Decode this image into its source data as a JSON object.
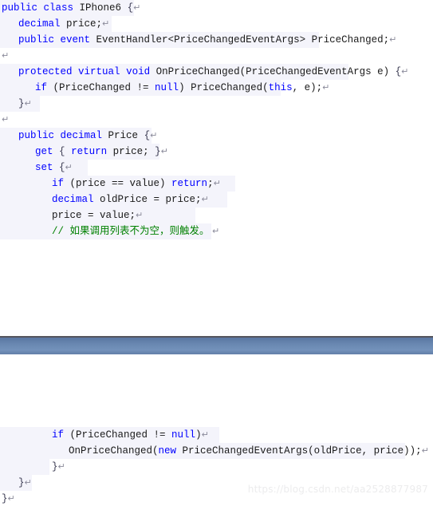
{
  "document": {
    "kind": "code-snippet-screenshot",
    "language": "C#",
    "watermark": "https://blog.csdn.net/aa2528877987",
    "colors": {
      "keyword": "#0000ff",
      "identifier": "#1a1a1a",
      "comment": "#008000",
      "pilcrow": "#8a8a9a",
      "line_wash": "#f4f4fb",
      "band_top": "#55555d",
      "band_fill_light": "#7391ba",
      "band_fill_dark": "#5a77a2",
      "watermark": "#ececed"
    },
    "paragraph_mark": "↵"
  },
  "blocks": [
    {
      "name": "top-block",
      "lines": [
        {
          "indent": 0,
          "tinted": true,
          "wash": 168,
          "tokens": [
            {
              "t": "public",
              "c": "kw"
            },
            {
              "t": " ",
              "c": "id"
            },
            {
              "t": "class",
              "c": "kw"
            },
            {
              "t": " IPhone6 ",
              "c": "id"
            },
            {
              "t": "{",
              "c": "brc"
            },
            {
              "t": "↵",
              "c": "pil"
            }
          ]
        },
        {
          "indent": 1,
          "tinted": true,
          "wash": 140,
          "tokens": [
            {
              "t": "decimal",
              "c": "kw"
            },
            {
              "t": " price;",
              "c": "id"
            },
            {
              "t": "↵",
              "c": "pil"
            }
          ]
        },
        {
          "indent": 1,
          "tinted": true,
          "wash": 400,
          "tokens": [
            {
              "t": "public",
              "c": "kw"
            },
            {
              "t": " ",
              "c": "id"
            },
            {
              "t": "event",
              "c": "kw"
            },
            {
              "t": " EventHandler<PriceChangedEventArgs> PriceChanged;",
              "c": "id"
            },
            {
              "t": "↵",
              "c": "pil"
            }
          ]
        },
        {
          "indent": 0,
          "tinted": false,
          "wash": 0,
          "tokens": [
            {
              "t": "↵",
              "c": "pil"
            }
          ]
        },
        {
          "indent": 1,
          "tinted": true,
          "wash": 437,
          "tokens": [
            {
              "t": "protected",
              "c": "kw"
            },
            {
              "t": " ",
              "c": "id"
            },
            {
              "t": "virtual",
              "c": "kw"
            },
            {
              "t": " ",
              "c": "id"
            },
            {
              "t": "void",
              "c": "kw"
            },
            {
              "t": " OnPriceChanged(PriceChangedEventArgs e) ",
              "c": "id"
            },
            {
              "t": "{",
              "c": "brc"
            },
            {
              "t": "↵",
              "c": "pil"
            }
          ]
        },
        {
          "indent": 2,
          "tinted": true,
          "wash": 352,
          "tokens": [
            {
              "t": "if",
              "c": "kw"
            },
            {
              "t": " (PriceChanged != ",
              "c": "id"
            },
            {
              "t": "null",
              "c": "kw"
            },
            {
              "t": ") PriceChanged(",
              "c": "id"
            },
            {
              "t": "this",
              "c": "kw"
            },
            {
              "t": ", e);",
              "c": "id"
            },
            {
              "t": "↵",
              "c": "pil"
            }
          ]
        },
        {
          "indent": 1,
          "tinted": true,
          "wash": 50,
          "tokens": [
            {
              "t": "}",
              "c": "brc"
            },
            {
              "t": "↵",
              "c": "pil"
            }
          ]
        },
        {
          "indent": 0,
          "tinted": false,
          "wash": 0,
          "tokens": [
            {
              "t": "↵",
              "c": "pil"
            }
          ]
        },
        {
          "indent": 1,
          "tinted": true,
          "wash": 190,
          "tokens": [
            {
              "t": "public",
              "c": "kw"
            },
            {
              "t": " ",
              "c": "id"
            },
            {
              "t": "decimal",
              "c": "kw"
            },
            {
              "t": " Price ",
              "c": "id"
            },
            {
              "t": "{",
              "c": "brc"
            },
            {
              "t": "↵",
              "c": "pil"
            }
          ]
        },
        {
          "indent": 2,
          "tinted": true,
          "wash": 200,
          "tokens": [
            {
              "t": "get",
              "c": "kw"
            },
            {
              "t": " ",
              "c": "id"
            },
            {
              "t": "{",
              "c": "brc"
            },
            {
              "t": " ",
              "c": "id"
            },
            {
              "t": "return",
              "c": "kw"
            },
            {
              "t": " price; ",
              "c": "id"
            },
            {
              "t": "}",
              "c": "brc"
            },
            {
              "t": "↵",
              "c": "pil"
            }
          ]
        },
        {
          "indent": 2,
          "tinted": true,
          "wash": 110,
          "tokens": [
            {
              "t": "set",
              "c": "kw"
            },
            {
              "t": " ",
              "c": "id"
            },
            {
              "t": "{",
              "c": "brc"
            },
            {
              "t": "↵",
              "c": "pil"
            }
          ]
        },
        {
          "indent": 3,
          "tinted": true,
          "wash": 295,
          "tokens": [
            {
              "t": "if",
              "c": "kw"
            },
            {
              "t": " (price == value) ",
              "c": "id"
            },
            {
              "t": "return",
              "c": "kw"
            },
            {
              "t": ";",
              "c": "id"
            },
            {
              "t": "↵",
              "c": "pil"
            }
          ]
        },
        {
          "indent": 3,
          "tinted": true,
          "wash": 285,
          "tokens": [
            {
              "t": "decimal",
              "c": "kw"
            },
            {
              "t": " oldPrice = price;",
              "c": "id"
            },
            {
              "t": "↵",
              "c": "pil"
            }
          ]
        },
        {
          "indent": 3,
          "tinted": true,
          "wash": 245,
          "tokens": [
            {
              "t": "price = value;",
              "c": "id"
            },
            {
              "t": "↵",
              "c": "pil"
            }
          ]
        },
        {
          "indent": 3,
          "tinted": true,
          "wash": 265,
          "tokens": [
            {
              "t": "// 如果调用列表不为空，则触发。",
              "c": "cmt"
            },
            {
              "t": " ↵",
              "c": "pil"
            }
          ]
        }
      ]
    },
    {
      "name": "bottom-block",
      "lines": [
        {
          "indent": 3,
          "tinted": true,
          "wash": 275,
          "tokens": [
            {
              "t": "if",
              "c": "kw"
            },
            {
              "t": " (PriceChanged != ",
              "c": "id"
            },
            {
              "t": "null",
              "c": "kw"
            },
            {
              "t": ")",
              "c": "id"
            },
            {
              "t": "↵",
              "c": "pil"
            }
          ]
        },
        {
          "indent": 4,
          "tinted": true,
          "wash": 508,
          "tokens": [
            {
              "t": "OnPriceChanged(",
              "c": "id"
            },
            {
              "t": "new",
              "c": "kw"
            },
            {
              "t": " PriceChangedEventArgs(oldPrice, price));",
              "c": "id"
            },
            {
              "t": "↵",
              "c": "pil"
            }
          ]
        },
        {
          "indent": 3,
          "tinted": true,
          "wash": 62,
          "tokens": [
            {
              "t": "}",
              "c": "brc"
            },
            {
              "t": "↵",
              "c": "pil"
            }
          ]
        },
        {
          "indent": 1,
          "tinted": true,
          "wash": 40,
          "tokens": [
            {
              "t": "}",
              "c": "brc"
            },
            {
              "t": "↵",
              "c": "pil"
            }
          ]
        },
        {
          "indent": 0,
          "tinted": false,
          "wash": 0,
          "tokens": [
            {
              "t": "}",
              "c": "brc"
            },
            {
              "t": "↵",
              "c": "pil"
            }
          ]
        }
      ]
    }
  ]
}
